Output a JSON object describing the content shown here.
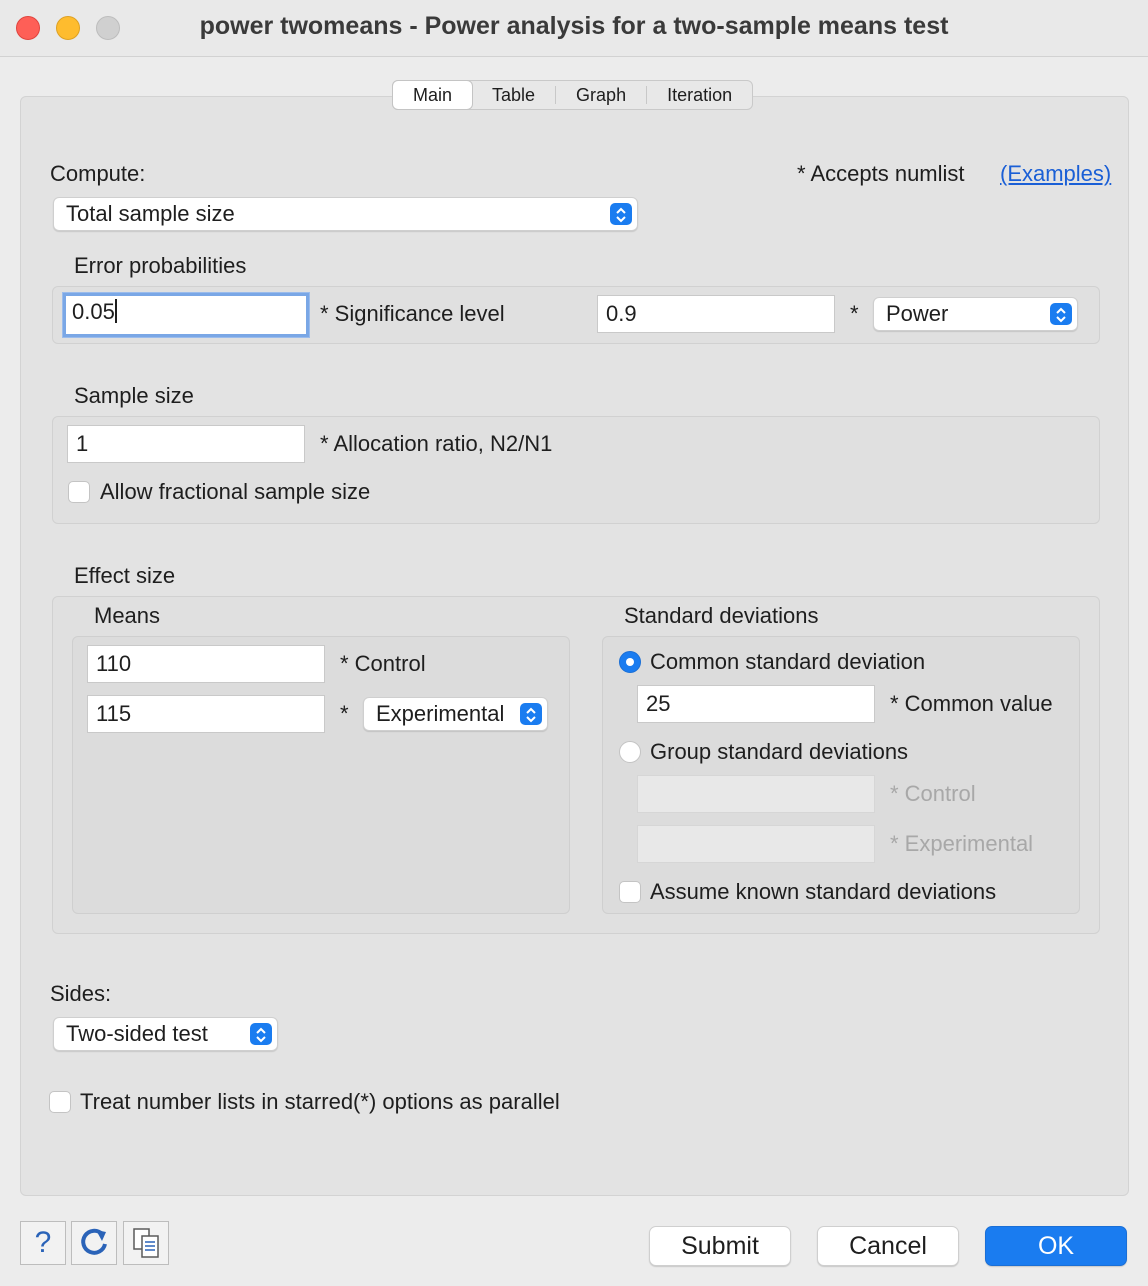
{
  "window": {
    "title": "power twomeans - Power analysis for a two-sample means test",
    "accent_color": "#1a7cf0"
  },
  "tabs": [
    {
      "label": "Main",
      "active": true
    },
    {
      "label": "Table",
      "active": false
    },
    {
      "label": "Graph",
      "active": false
    },
    {
      "label": "Iteration",
      "active": false
    }
  ],
  "compute": {
    "label": "Compute:",
    "selected": "Total sample size",
    "numlist_note": "* Accepts numlist",
    "examples_link": "(Examples)"
  },
  "error_probabilities": {
    "heading": "Error probabilities",
    "significance_value": "0.05",
    "significance_label": "* Significance level",
    "power_value": "0.9",
    "power_star": "*",
    "power_selected": "Power"
  },
  "sample_size": {
    "heading": "Sample size",
    "allocation_value": "1",
    "allocation_label": "* Allocation ratio, N2/N1",
    "fractional_label": "Allow fractional sample size",
    "fractional_checked": false
  },
  "effect_size": {
    "heading": "Effect size",
    "means": {
      "heading": "Means",
      "control_value": "110",
      "control_label": "* Control",
      "experimental_value": "115",
      "experimental_star": "*",
      "experimental_selected": "Experimental"
    },
    "std_devs": {
      "heading": "Standard deviations",
      "common_option": "Common standard deviation",
      "common_selected": true,
      "common_value": "25",
      "common_value_label": "* Common value",
      "group_option": "Group standard deviations",
      "group_control_label": "* Control",
      "group_experimental_label": "* Experimental",
      "assume_known_label": "Assume known standard deviations",
      "assume_known_checked": false
    }
  },
  "sides": {
    "label": "Sides:",
    "selected": "Two-sided test"
  },
  "parallel": {
    "label": "Treat number lists in starred(*) options as parallel",
    "checked": false
  },
  "buttons": {
    "help": "?",
    "submit": "Submit",
    "cancel": "Cancel",
    "ok": "OK"
  }
}
